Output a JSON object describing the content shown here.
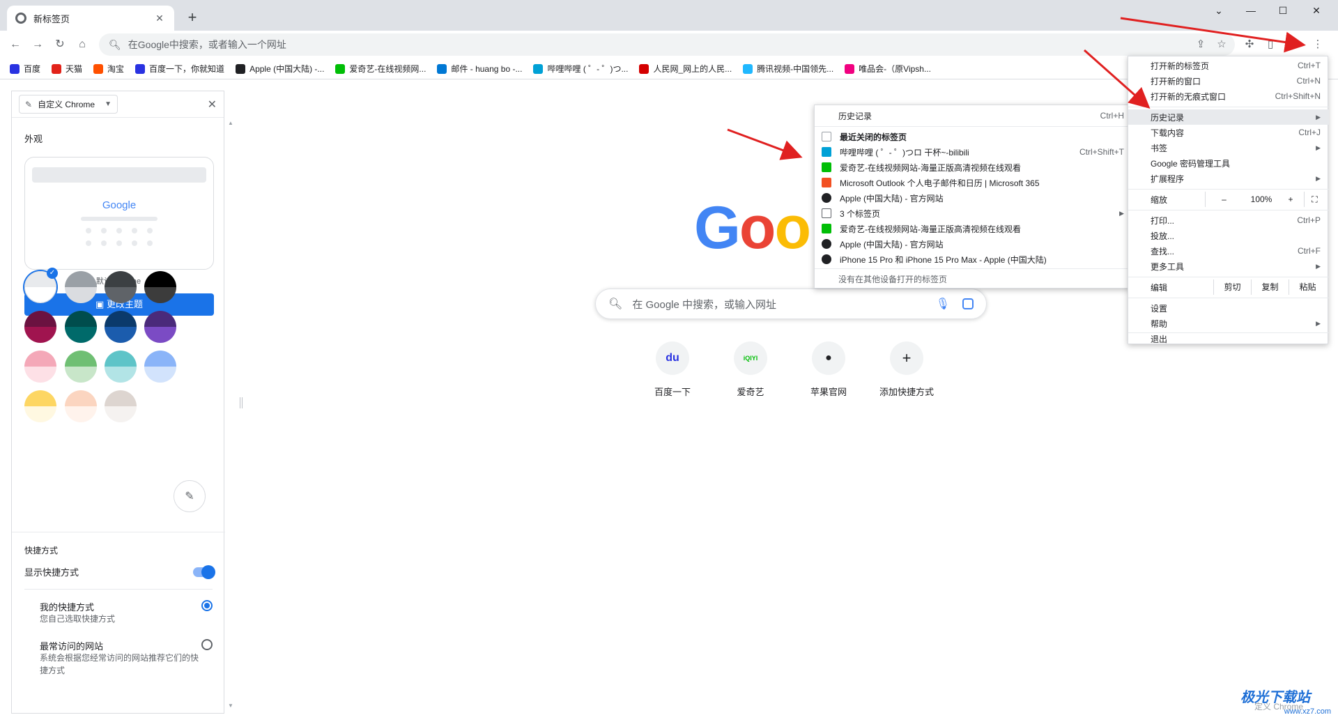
{
  "tab": {
    "title": "新标签页"
  },
  "toolbar": {
    "omnibox_placeholder": "在Google中搜索，或者输入一个网址"
  },
  "bookmarks": [
    {
      "label": "百度",
      "color": "#2932e1"
    },
    {
      "label": "天猫",
      "color": "#e2231a"
    },
    {
      "label": "淘宝",
      "color": "#ff5000"
    },
    {
      "label": "百度一下，你就知道",
      "color": "#2932e1"
    },
    {
      "label": "Apple (中国大陆) -...",
      "color": "#202124"
    },
    {
      "label": "爱奇艺-在线视频网...",
      "color": "#00be06"
    },
    {
      "label": "邮件 - huang bo -...",
      "color": "#0078d4"
    },
    {
      "label": "哔哩哔哩 ( ゜- ゜)つ...",
      "color": "#00a1d6"
    },
    {
      "label": "人民网_网上的人民...",
      "color": "#d40000"
    },
    {
      "label": "腾讯视频-中国领先...",
      "color": "#20b8ff"
    },
    {
      "label": "唯品会-（原Vipsh...",
      "color": "#f10180"
    }
  ],
  "side_panel": {
    "selector": "自定义 Chrome",
    "appearance": "外观",
    "preview_logo": "Google",
    "theme_name": "默认 Chrome",
    "change_theme": "更改主题",
    "shortcuts_title": "快捷方式",
    "show_shortcuts": "显示快捷方式",
    "my_shortcuts": "我的快捷方式",
    "my_shortcuts_sub": "您自己选取快捷方式",
    "most_visited": "最常访问的网站",
    "most_visited_sub": "系统会根据您经常访问的网站推荐它们的快捷方式",
    "swatches": [
      {
        "top": "#e8eaed",
        "bot": "#ffffff"
      },
      {
        "top": "#9aa0a6",
        "bot": "#dadce0"
      },
      {
        "top": "#3c4043",
        "bot": "#5f6368"
      },
      {
        "top": "#000000",
        "bot": "#3c3c3c"
      },
      {
        "top": "#6b1240",
        "bot": "#a0144f"
      },
      {
        "top": "#004d4d",
        "bot": "#006a6a"
      },
      {
        "top": "#0b3a6b",
        "bot": "#1b5cad"
      },
      {
        "top": "#4a2a7a",
        "bot": "#7b4bc4"
      },
      {
        "top": "#f4a8b8",
        "bot": "#fde0e6"
      },
      {
        "top": "#6fbf73",
        "bot": "#c8e6c9"
      },
      {
        "top": "#5ec4c8",
        "bot": "#b2e4e6"
      },
      {
        "top": "#8ab4f8",
        "bot": "#d2e3fc"
      },
      {
        "top": "#fdd663",
        "bot": "#fff8e1"
      },
      {
        "top": "#fbd5c0",
        "bot": "#fff3ec"
      },
      {
        "top": "#ddd5d0",
        "bot": "#f5f2f0"
      }
    ]
  },
  "main": {
    "logo": "Goo",
    "search_placeholder": "在 Google 中搜索，或输入网址",
    "shortcuts": [
      {
        "label": "百度一下",
        "glyph": "du",
        "color": "#2932e1"
      },
      {
        "label": "爱奇艺",
        "glyph": "iQIYI",
        "color": "#00be06"
      },
      {
        "label": "苹果官网",
        "glyph": "",
        "color": "#202124"
      },
      {
        "label": "添加快捷方式",
        "glyph": "+",
        "color": "#202124"
      }
    ]
  },
  "menu": {
    "new_tab": "打开新的标签页",
    "new_tab_key": "Ctrl+T",
    "new_window": "打开新的窗口",
    "new_window_key": "Ctrl+N",
    "incognito": "打开新的无痕式窗口",
    "incognito_key": "Ctrl+Shift+N",
    "history": "历史记录",
    "downloads": "下载内容",
    "downloads_key": "Ctrl+J",
    "bookmarks": "书签",
    "passwords": "Google 密码管理工具",
    "extensions": "扩展程序",
    "zoom": "缩放",
    "zoom_minus": "–",
    "zoom_level": "100%",
    "zoom_plus": "+",
    "print": "打印...",
    "print_key": "Ctrl+P",
    "cast": "投放...",
    "find": "查找...",
    "find_key": "Ctrl+F",
    "more_tools": "更多工具",
    "edit": "编辑",
    "cut": "剪切",
    "copy": "复制",
    "paste": "粘贴",
    "settings": "设置",
    "help": "帮助",
    "exit": "退出"
  },
  "history": {
    "header": "历史记录",
    "header_key": "Ctrl+H",
    "recent_closed": "最近关闭的标签页",
    "items": [
      {
        "label": "哔哩哔哩 ( ゜- ゜)つロ 干杯~-bilibili",
        "key": "Ctrl+Shift+T",
        "color": "#00a1d6"
      },
      {
        "label": "爱奇艺-在线视频网站-海量正版高清视频在线观看",
        "key": "",
        "color": "#00be06"
      },
      {
        "label": "Microsoft Outlook 个人电子邮件和日历 | Microsoft 365",
        "key": "",
        "color": "#f25022"
      },
      {
        "label": "Apple (中国大陆) - 官方网站",
        "key": "",
        "color": "#202124"
      },
      {
        "label": "3 个标签页",
        "key": "",
        "color": "#5f6368"
      },
      {
        "label": "爱奇艺-在线视频网站-海量正版高清视频在线观看",
        "key": "",
        "color": "#00be06"
      },
      {
        "label": "Apple (中国大陆) - 官方网站",
        "key": "",
        "color": "#202124"
      },
      {
        "label": "iPhone 15 Pro 和 iPhone 15 Pro Max - Apple (中国大陆)",
        "key": "",
        "color": "#202124"
      }
    ],
    "no_other_devices": "没有在其他设备打开的标签页"
  },
  "watermark": {
    "line1": "极光下载站",
    "line2": "www.xz7.com"
  },
  "faint_text": "定义 Chrome",
  "colors": {
    "accent": "#1a73e8",
    "arrow": "#e02020"
  }
}
